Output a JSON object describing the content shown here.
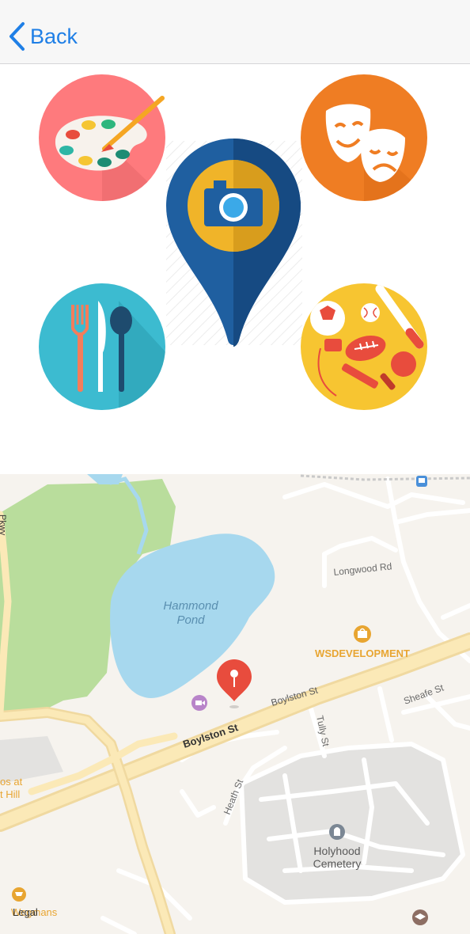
{
  "nav": {
    "back_label": "Back"
  },
  "map": {
    "labels": {
      "pond_line1": "Hammond",
      "pond_line2": "Pond",
      "longwood": "Longwood Rd",
      "wsdevelopment": "WSDEVELOPMENT",
      "boylston_small": "Boylston St",
      "boylston_big": "Boylston St",
      "sheafe": "Sheafe St",
      "tully": "Tully St",
      "heath": "Heath St",
      "cemetery_line1": "Holyhood",
      "cemetery_line2": "Cemetery",
      "shops_line1": "os at",
      "shops_line2": "t Hill",
      "wegmans": "Wegmans",
      "legal": "Legal",
      "pkwy": "Pkwy"
    }
  },
  "colors": {
    "link_blue": "#1f7fe6",
    "pin_red": "#e84c3d",
    "park_green": "#b9dd9c",
    "water_blue": "#a7d8ee",
    "poi_orange": "#e8a531"
  },
  "icons": [
    "back-chevron-icon",
    "art-palette-icon",
    "theater-masks-icon",
    "camera-location-pin-icon",
    "dining-utensils-icon",
    "sports-equipment-icon",
    "location-pin-icon",
    "cinema-icon",
    "shopping-bag-icon",
    "cemetery-icon",
    "university-icon",
    "train-icon",
    "cart-icon"
  ]
}
